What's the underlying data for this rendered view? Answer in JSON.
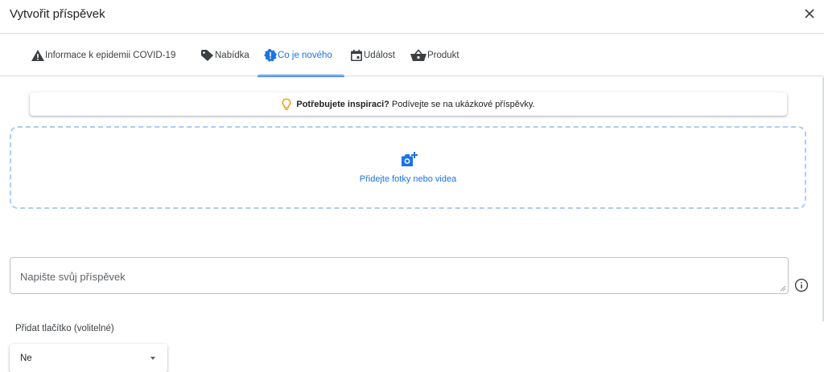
{
  "dialog": {
    "title": "Vytvořit příspěvek",
    "close_icon": "close-icon"
  },
  "tabs": [
    {
      "label": "Informace k epidemii COVID-19",
      "icon": "warning-icon",
      "active": false
    },
    {
      "label": "Nabídka",
      "icon": "tag-icon",
      "active": false
    },
    {
      "label": "Co je nového",
      "icon": "alert-badge-icon",
      "active": true
    },
    {
      "label": "Událost",
      "icon": "calendar-icon",
      "active": false
    },
    {
      "label": "Produkt",
      "icon": "basket-icon",
      "active": false
    }
  ],
  "inspiration": {
    "icon": "lightbulb-icon",
    "bold": "Potřebujete inspiraci?",
    "text": "Podívejte se na ukázkové příspěvky."
  },
  "upload": {
    "icon": "add-photo-icon",
    "label": "Přidejte fotky nebo videa"
  },
  "post": {
    "placeholder": "Napište svůj příspěvek",
    "info_icon": "info-icon"
  },
  "button_section": {
    "label": "Přidat tlačítko (volitelné)",
    "selected": "Ne"
  },
  "colors": {
    "accent": "#1a73e8",
    "dashed_border": "#aecbfa",
    "bulb": "#f29900",
    "divider": "#dadce0"
  }
}
